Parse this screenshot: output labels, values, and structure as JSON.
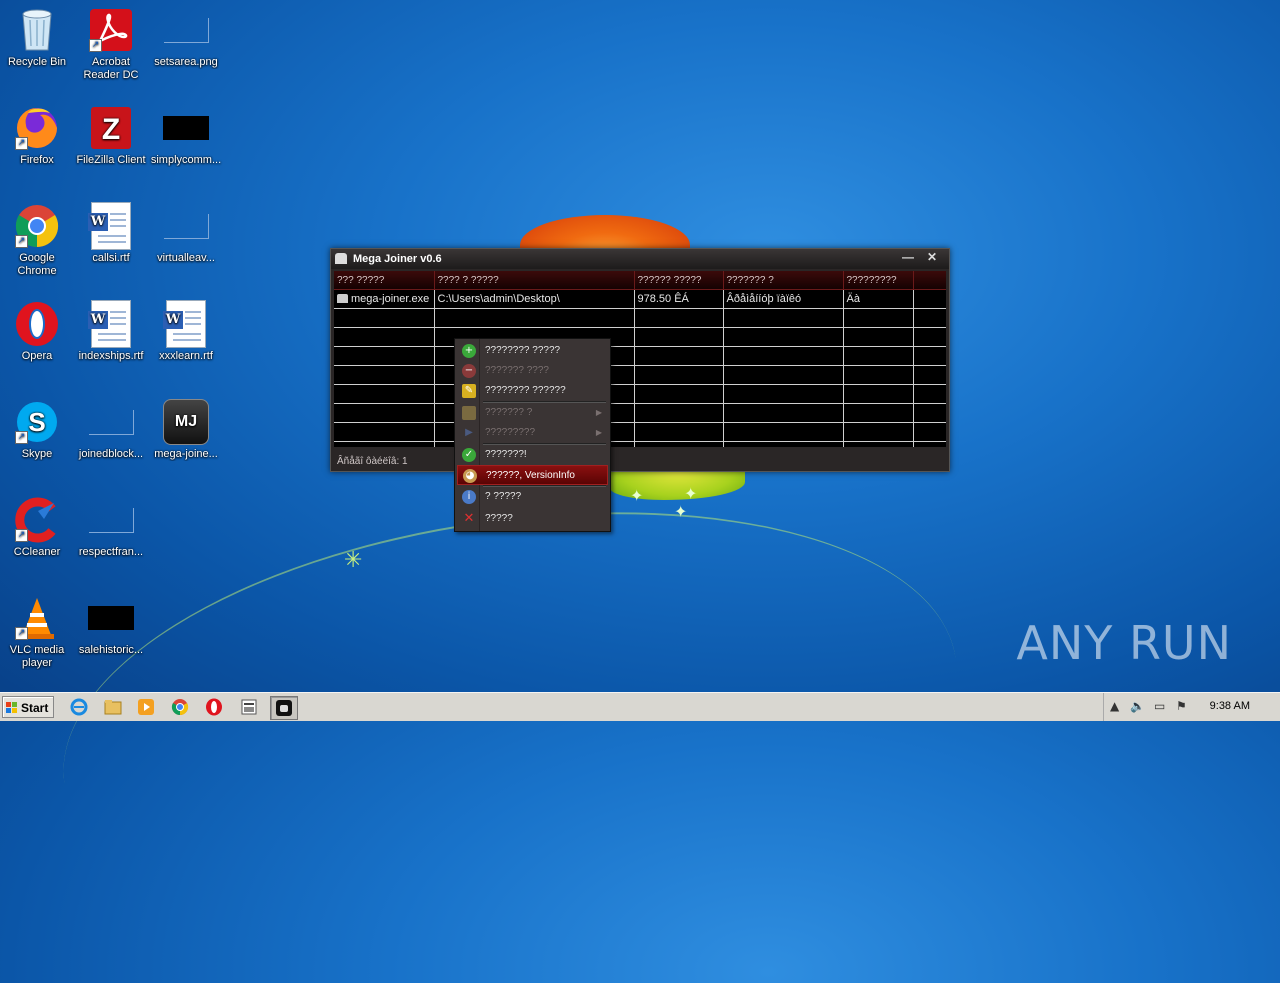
{
  "desktop_icons": [
    {
      "id": "recycle-bin",
      "label": "Recycle Bin"
    },
    {
      "id": "acrobat",
      "label": "Acrobat Reader DC"
    },
    {
      "id": "setsarea",
      "label": "setsarea.png"
    },
    {
      "id": "firefox",
      "label": "Firefox"
    },
    {
      "id": "filezilla",
      "label": "FileZilla Client"
    },
    {
      "id": "simplycomm",
      "label": "simplycomm..."
    },
    {
      "id": "chrome",
      "label": "Google Chrome"
    },
    {
      "id": "callsi",
      "label": "callsi.rtf"
    },
    {
      "id": "virtualleav",
      "label": "virtualleav..."
    },
    {
      "id": "opera",
      "label": "Opera"
    },
    {
      "id": "indexships",
      "label": "indexships.rtf"
    },
    {
      "id": "xxxlearn",
      "label": "xxxlearn.rtf"
    },
    {
      "id": "skype",
      "label": "Skype"
    },
    {
      "id": "joinedblock",
      "label": "joinedblock..."
    },
    {
      "id": "megajoiner",
      "label": "mega-joine..."
    },
    {
      "id": "ccleaner",
      "label": "CCleaner"
    },
    {
      "id": "respectfran",
      "label": "respectfran..."
    },
    {
      "id": "vlc",
      "label": "VLC media player"
    },
    {
      "id": "salehistoric",
      "label": "salehistoric..."
    }
  ],
  "mj_logo": "MJ",
  "watermark": "ANY RUN",
  "window": {
    "title": "Mega Joiner v0.6",
    "minimize": "—",
    "close": "✕",
    "columns": [
      "??? ?????",
      "???? ? ?????",
      "?????? ?????",
      "??????? ?",
      "?????????"
    ],
    "row": [
      "mega-joiner.exe",
      "C:\\Users\\admin\\Desktop\\",
      "978.50 ÊÁ",
      "Âðåìåííóþ ïàïêó",
      "Äà"
    ],
    "status": "Âñåãî ôàéëîâ: 1"
  },
  "context_menu": {
    "items": [
      {
        "label": "???????? ?????",
        "disabled": false,
        "icon": "add-icon",
        "color": "#3aa83a",
        "glyph": "+"
      },
      {
        "label": "??????? ????",
        "disabled": true,
        "icon": "remove-icon",
        "color": "#8a3a3a",
        "glyph": "−"
      },
      {
        "label": "???????? ??????",
        "disabled": false,
        "icon": "broom-icon",
        "color": "#d8b020",
        "glyph": "✎"
      },
      {
        "label": "??????? ?",
        "disabled": true,
        "icon": "folder-icon",
        "color": "#7a6a40",
        "glyph": "▪",
        "submenu": true
      },
      {
        "label": "?????????",
        "disabled": true,
        "icon": "play-icon",
        "color": "#3a4a6a",
        "glyph": "▶",
        "submenu": true
      },
      {
        "label": "???????!",
        "disabled": false,
        "icon": "check-icon",
        "color": "#3aa83a",
        "glyph": "✓"
      },
      {
        "label": "??????, VersionInfo",
        "disabled": false,
        "selected": true,
        "icon": "palette-icon",
        "color": "#c89a50",
        "glyph": "◕"
      },
      {
        "label": "? ?????",
        "disabled": false,
        "icon": "info-icon",
        "color": "#4a7ac8",
        "glyph": "i"
      },
      {
        "label": "?????",
        "disabled": false,
        "icon": "close-icon",
        "color": "#d83030",
        "glyph": "✕"
      }
    ]
  },
  "taskbar": {
    "start_label": "Start",
    "clock": "9:38 AM",
    "pinned": [
      "internet-explorer-icon",
      "explorer-icon",
      "media-player-icon",
      "chrome-icon",
      "opera-icon",
      "joiner-task-icon",
      "mega-joiner-task-icon"
    ]
  }
}
